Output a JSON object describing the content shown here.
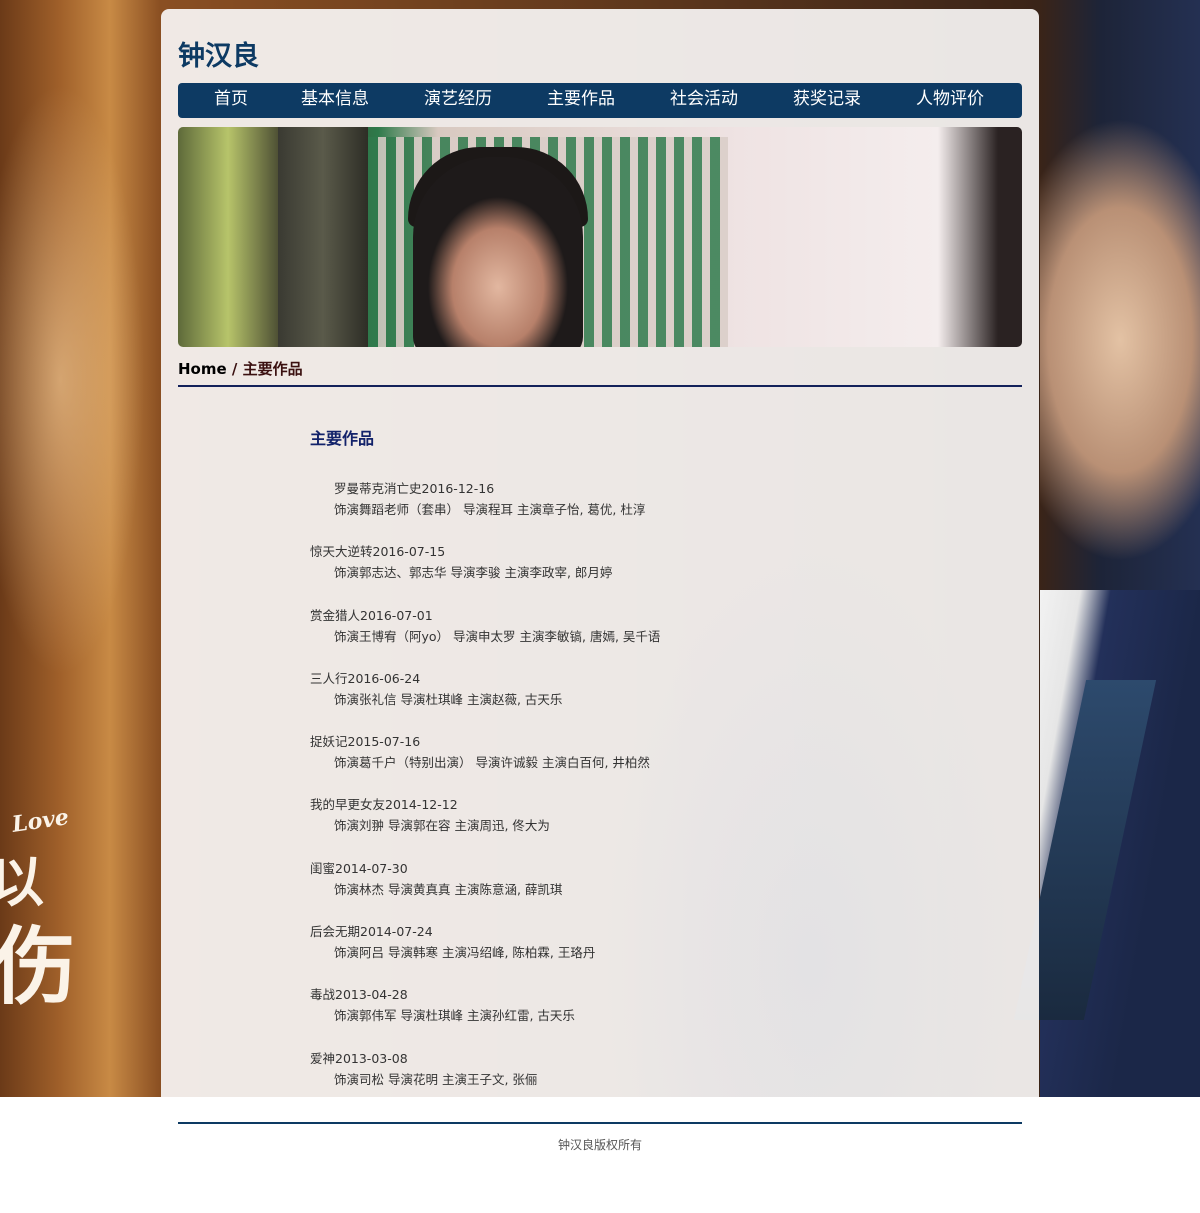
{
  "site": {
    "title": "钟汉良",
    "background_text": {
      "love": "Love",
      "char1": "以",
      "char2": "伤"
    }
  },
  "nav": {
    "items": [
      {
        "label": "首页"
      },
      {
        "label": "基本信息"
      },
      {
        "label": "演艺经历"
      },
      {
        "label": "主要作品"
      },
      {
        "label": "社会活动"
      },
      {
        "label": "获奖记录"
      },
      {
        "label": "人物评价"
      }
    ]
  },
  "breadcrumb": {
    "home": "Home",
    "separator": " / ",
    "current": "主要作品"
  },
  "main": {
    "section_title": "主要作品",
    "works": [
      {
        "title": "罗曼蒂克消亡史2016-12-16",
        "detail": "饰演舞蹈老师（套串） 导演程耳 主演章子怡, 葛优, 杜淳"
      },
      {
        "title": "惊天大逆转2016-07-15",
        "detail": "饰演郭志达、郭志华 导演李骏 主演李政宰, 郎月婷"
      },
      {
        "title": "赏金猎人2016-07-01",
        "detail": "饰演王博宥（阿yo） 导演申太罗 主演李敏镐, 唐嫣, 吴千语"
      },
      {
        "title": "三人行2016-06-24",
        "detail": "饰演张礼信 导演杜琪峰 主演赵薇, 古天乐"
      },
      {
        "title": "捉妖记2015-07-16",
        "detail": "饰演葛千户（特别出演） 导演许诚毅 主演白百何, 井柏然"
      },
      {
        "title": "我的早更女友2014-12-12",
        "detail": "饰演刘翀 导演郭在容 主演周迅, 佟大为"
      },
      {
        "title": "闺蜜2014-07-30",
        "detail": "饰演林杰 导演黄真真 主演陈意涵, 薛凯琪"
      },
      {
        "title": "后会无期2014-07-24",
        "detail": "饰演阿吕 导演韩寒 主演冯绍峰, 陈柏霖, 王珞丹"
      },
      {
        "title": "毒战2013-04-28",
        "detail": "饰演郭伟军 导演杜琪峰 主演孙红雷, 古天乐"
      },
      {
        "title": "爱神2013-03-08",
        "detail": "饰演司松 导演花明 主演王子文, 张俪"
      }
    ]
  },
  "footer": {
    "copyright": "钟汉良版权所有"
  },
  "colors": {
    "brand_navy": "#0d3a63",
    "rule_navy": "#13215a",
    "title_blue": "#12226a"
  }
}
